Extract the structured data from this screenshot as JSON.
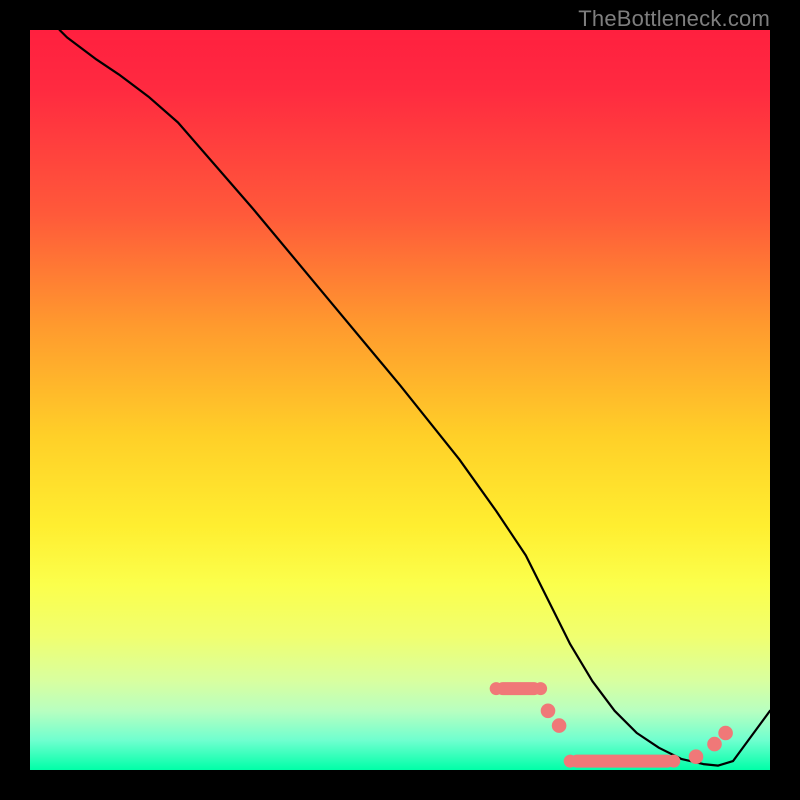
{
  "attribution": "TheBottleneck.com",
  "chart_data": {
    "type": "line",
    "title": "",
    "xlabel": "",
    "ylabel": "",
    "xlim": [
      0,
      100
    ],
    "ylim": [
      0,
      100
    ],
    "grid": false,
    "legend": false,
    "series": [
      {
        "name": "bottleneck-curve",
        "color": "#000000",
        "x": [
          4,
          5,
          7,
          9,
          12,
          16,
          20,
          30,
          40,
          50,
          58,
          63,
          67,
          70,
          73,
          76,
          79,
          82,
          85,
          88,
          91,
          93,
          95,
          100
        ],
        "y": [
          100,
          99,
          97.5,
          96,
          94,
          91,
          87.5,
          76,
          64,
          52,
          42,
          35,
          29,
          23,
          17,
          12,
          8,
          5,
          3,
          1.5,
          0.8,
          0.6,
          1.2,
          8
        ]
      }
    ],
    "markers": [
      {
        "shape": "rounded-bar",
        "color": "#f07878",
        "x_start": 63,
        "x_end": 69,
        "y": 11,
        "note": "upper-dash-cluster"
      },
      {
        "shape": "dot",
        "color": "#f07878",
        "x": 70,
        "y": 8,
        "r": 1.1
      },
      {
        "shape": "dot",
        "color": "#f07878",
        "x": 71.5,
        "y": 6,
        "r": 1.1
      },
      {
        "shape": "rounded-bar",
        "color": "#f07878",
        "x_start": 73,
        "x_end": 87,
        "y": 1.2,
        "note": "bottom-dash-cluster"
      },
      {
        "shape": "dot",
        "color": "#f07878",
        "x": 90,
        "y": 1.8,
        "r": 1.1
      },
      {
        "shape": "dot",
        "color": "#f07878",
        "x": 92.5,
        "y": 3.5,
        "r": 1.1
      },
      {
        "shape": "dot",
        "color": "#f07878",
        "x": 94,
        "y": 5,
        "r": 1.1
      }
    ],
    "background_gradient": {
      "type": "vertical",
      "stops": [
        {
          "pos": 0.0,
          "color": "#ff203f"
        },
        {
          "pos": 0.25,
          "color": "#ff5a3a"
        },
        {
          "pos": 0.55,
          "color": "#ffd028"
        },
        {
          "pos": 0.75,
          "color": "#fbff4c"
        },
        {
          "pos": 0.92,
          "color": "#b8ffc0"
        },
        {
          "pos": 1.0,
          "color": "#00ffa8"
        }
      ]
    }
  }
}
